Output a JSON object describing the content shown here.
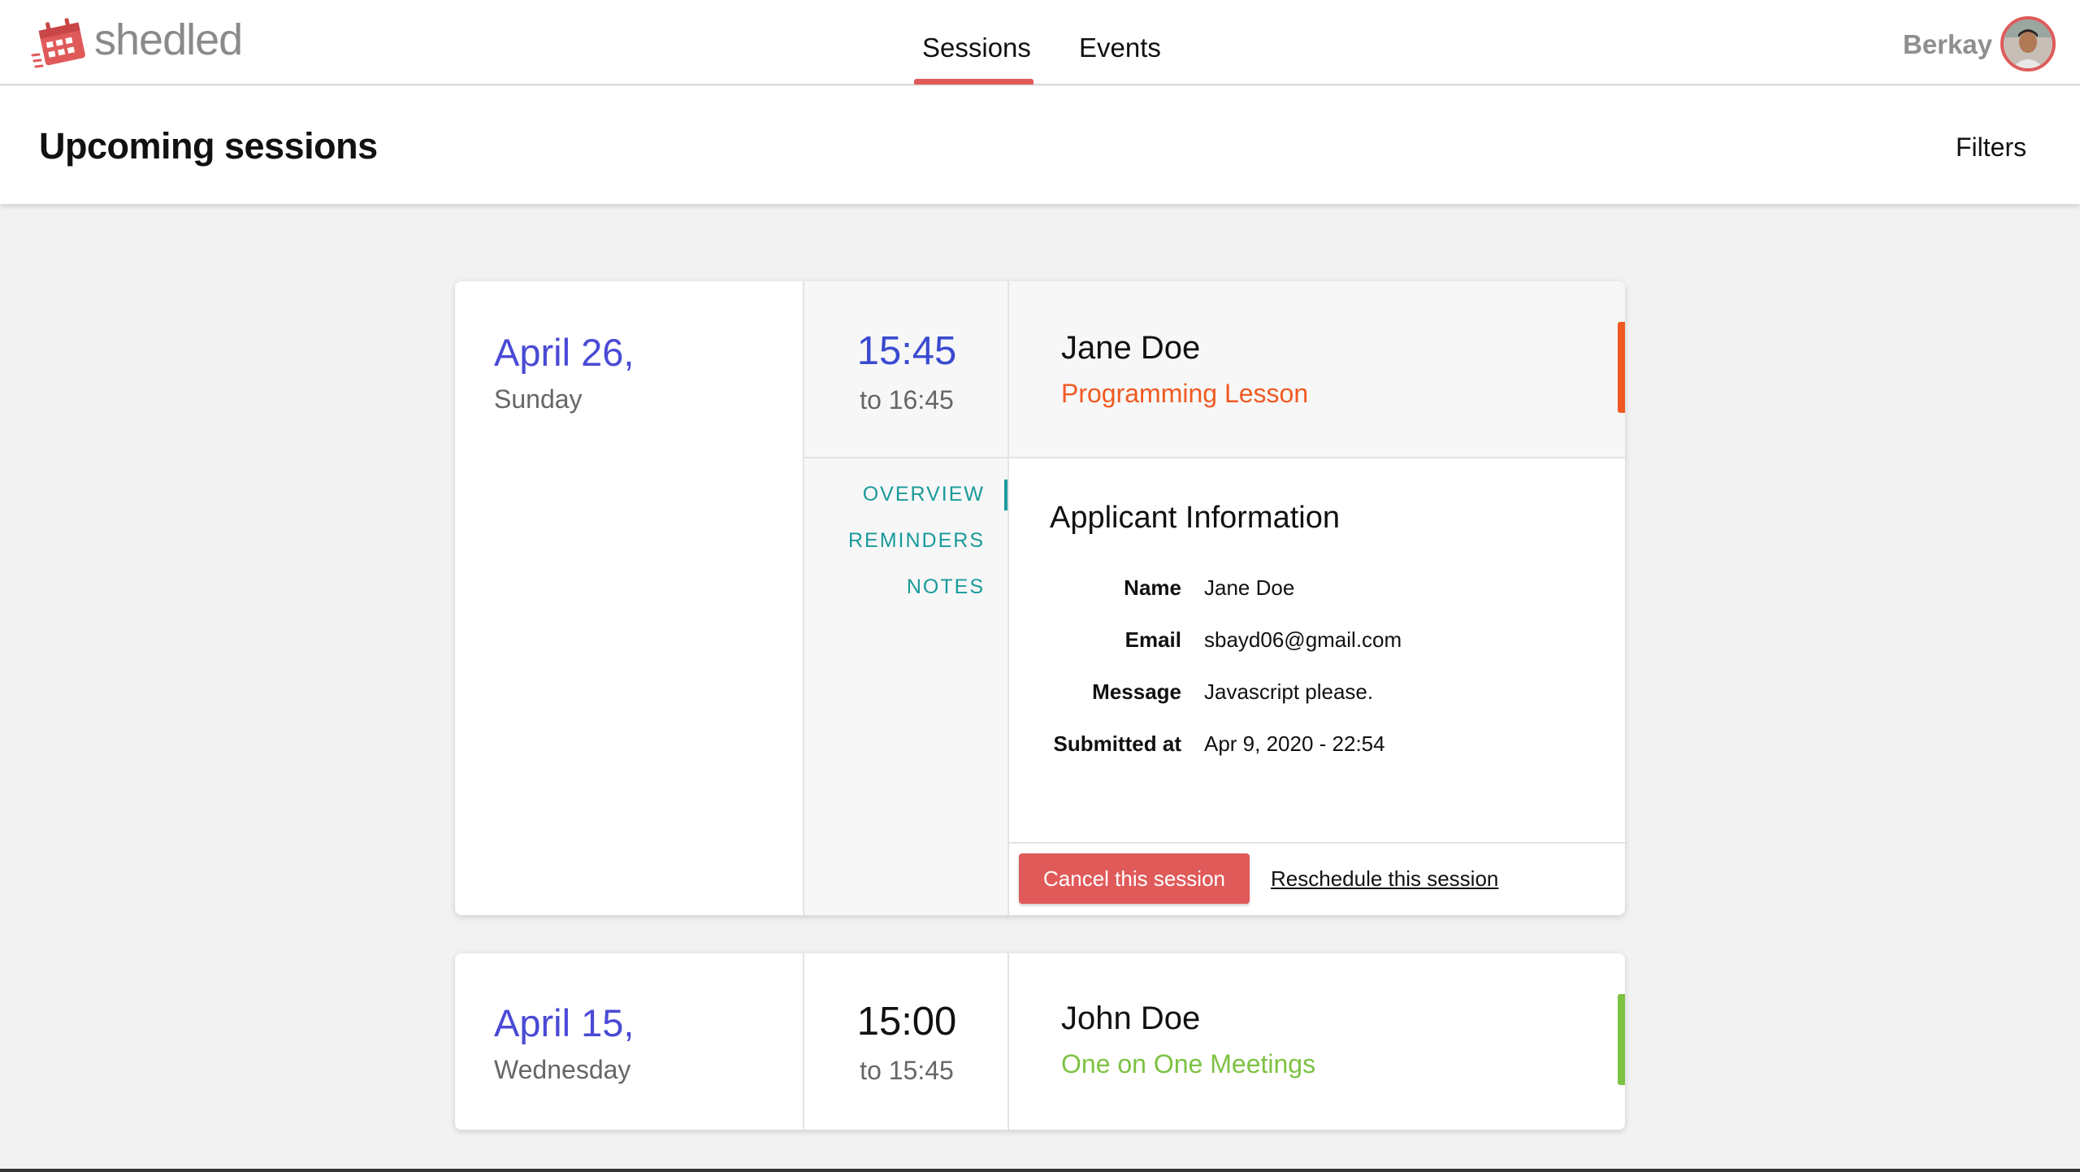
{
  "app": {
    "brand": "shedled",
    "brand_color": "#e05a5a"
  },
  "nav": {
    "tabs": [
      {
        "label": "Sessions",
        "active": true
      },
      {
        "label": "Events",
        "active": false
      }
    ]
  },
  "user": {
    "name": "Berkay"
  },
  "header": {
    "title": "Upcoming sessions",
    "filters_label": "Filters"
  },
  "sessions": [
    {
      "date": "April 26,",
      "weekday": "Sunday",
      "start": "15:45",
      "end": "to 16:45",
      "person": "Jane Doe",
      "type": "Programming Lesson",
      "type_color": "#f05a22",
      "expanded": true,
      "side_tabs": [
        "OVERVIEW",
        "REMINDERS",
        "NOTES"
      ],
      "active_tab": "OVERVIEW",
      "detail": {
        "title": "Applicant Information",
        "fields": [
          {
            "label": "Name",
            "value": "Jane Doe"
          },
          {
            "label": "Email",
            "value": "sbayd06@gmail.com"
          },
          {
            "label": "Message",
            "value": "Javascript please."
          },
          {
            "label": "Submitted at",
            "value": "Apr 9, 2020 - 22:54"
          }
        ]
      },
      "actions": {
        "cancel": "Cancel this session",
        "reschedule": "Reschedule this session"
      }
    },
    {
      "date": "April 15,",
      "weekday": "Wednesday",
      "start": "15:00",
      "end": "to 15:45",
      "person": "John Doe",
      "type": "One on One Meetings",
      "type_color": "#7dc242",
      "expanded": false
    }
  ]
}
